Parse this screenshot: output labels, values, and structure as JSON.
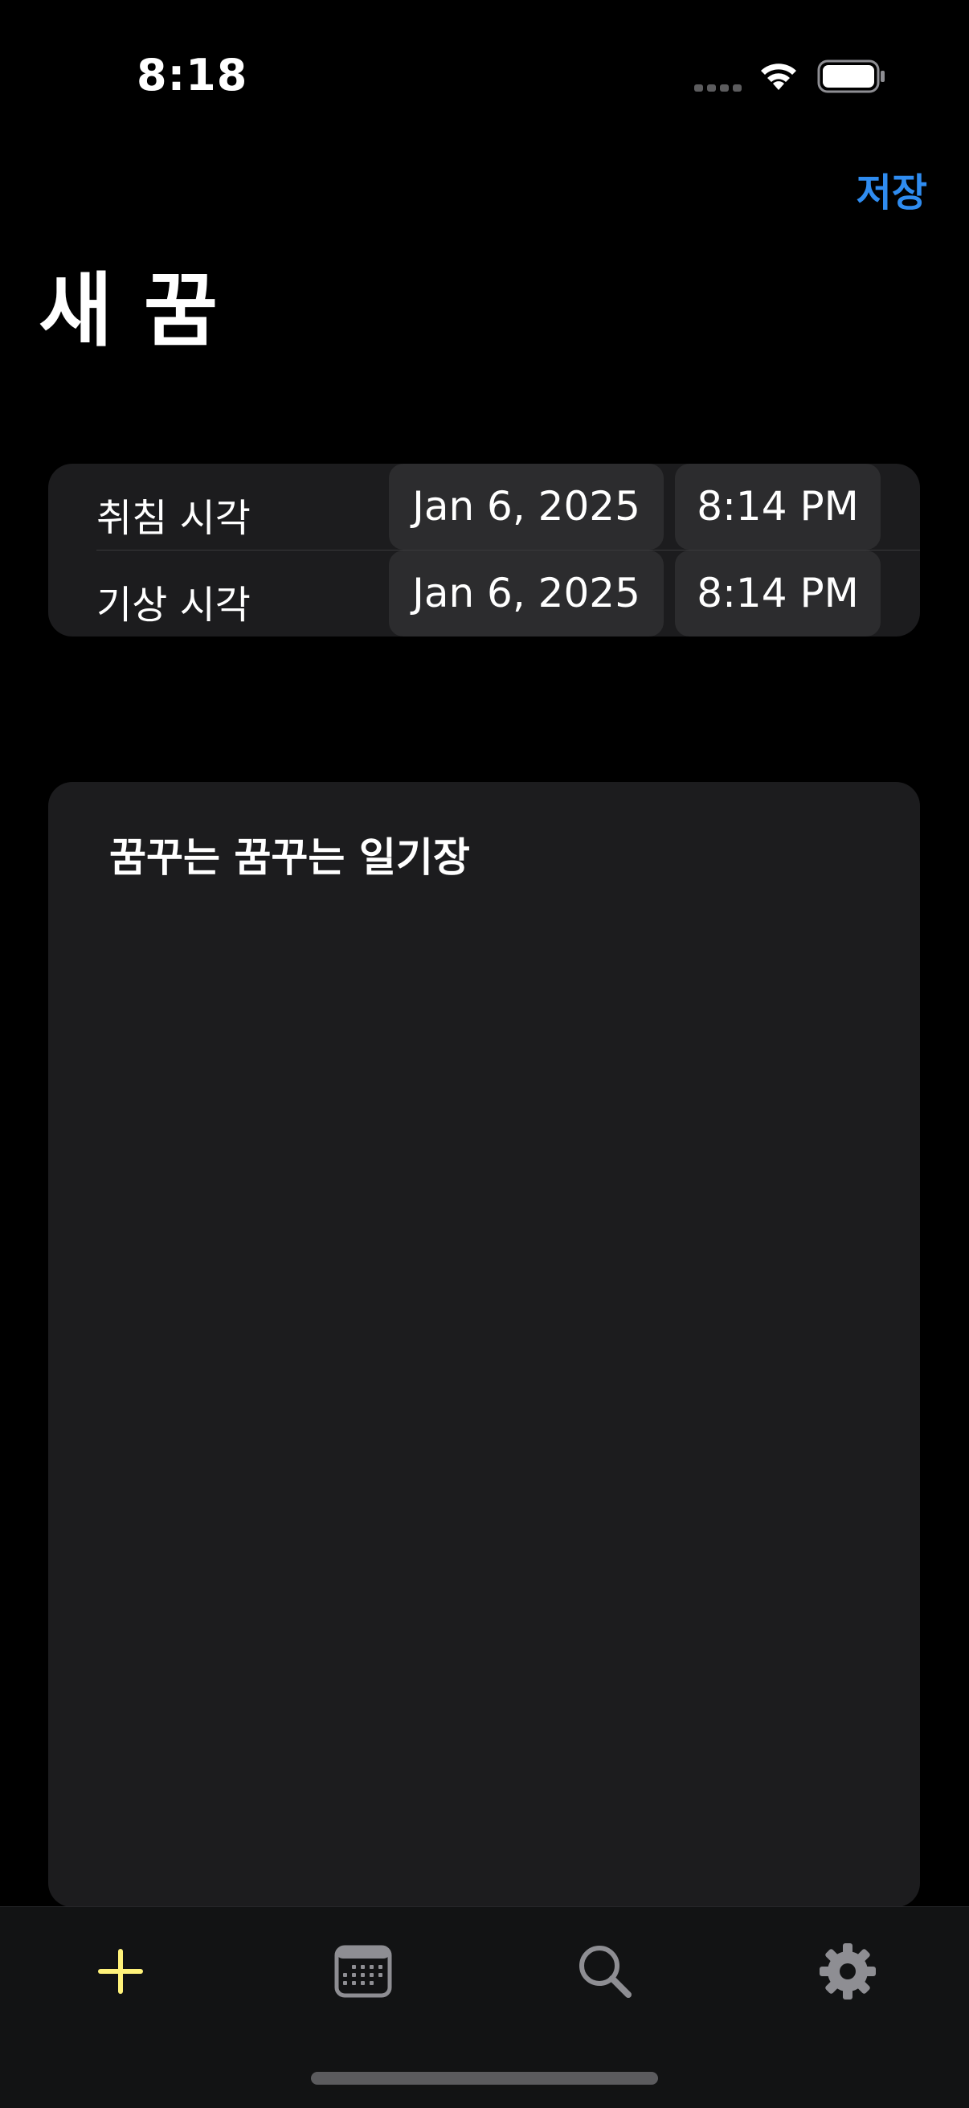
{
  "status_bar": {
    "time": "8:18"
  },
  "nav": {
    "save_label": "저장",
    "title": "새 꿈"
  },
  "time_card": {
    "rows": [
      {
        "label": "취침 시각",
        "date": "Jan 6, 2025",
        "time": "8:14 PM"
      },
      {
        "label": "기상 시각",
        "date": "Jan 6, 2025",
        "time": "8:14 PM"
      }
    ]
  },
  "dream": {
    "title": "꿈꾸는 꿈꾸는 일기장"
  },
  "tab_bar": {
    "items": [
      {
        "icon": "plus-icon",
        "active": true
      },
      {
        "icon": "calendar-icon",
        "active": false
      },
      {
        "icon": "search-icon",
        "active": false
      },
      {
        "icon": "gear-icon",
        "active": false
      }
    ]
  },
  "colors": {
    "accent": "#2f8cf0",
    "active_tab": "#fff27a",
    "inactive_tab": "#8e8e93",
    "card_bg": "#1c1c1e",
    "pill_bg": "#2c2c2e"
  }
}
